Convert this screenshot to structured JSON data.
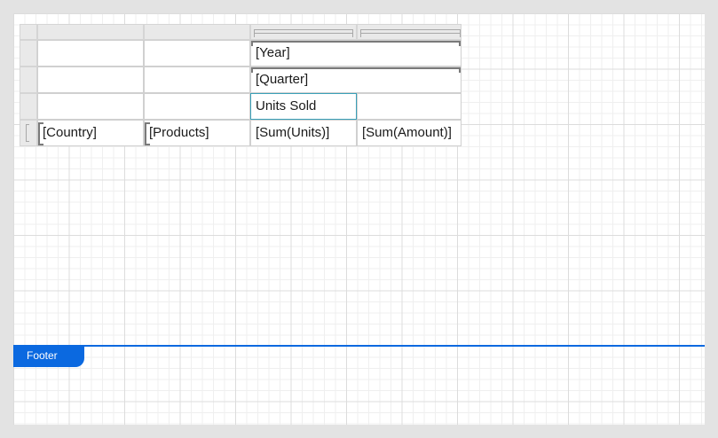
{
  "matrix": {
    "row_groups": [
      "[Year]",
      "[Quarter]"
    ],
    "header_static": "Units Sold",
    "detail_row": [
      "[Country]",
      "[Products]",
      "[Sum(Units)]",
      "[Sum(Amount)]"
    ]
  },
  "footer": {
    "label": "Footer"
  },
  "colors": {
    "accent": "#0b69e0",
    "selection": "#3aa0b8"
  }
}
